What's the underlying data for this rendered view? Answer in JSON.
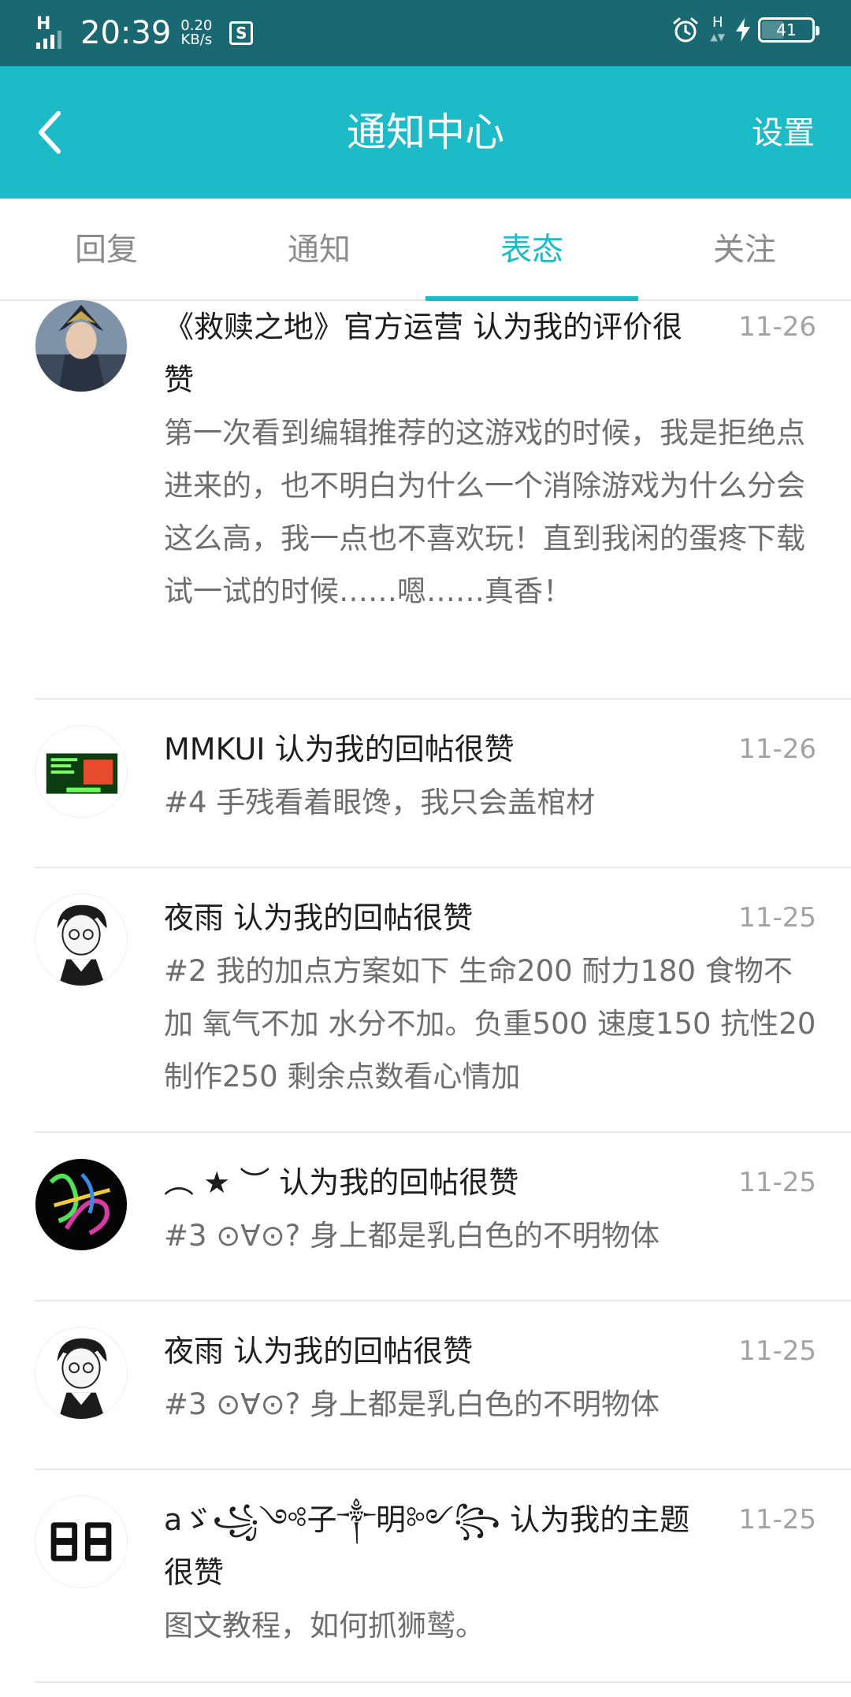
{
  "status_bar": {
    "signal_label": "H",
    "time": "20:39",
    "speed_value": "0.20",
    "speed_unit": "KB/s",
    "app_icon_letter": "S",
    "net_label": "H",
    "battery": "41"
  },
  "header": {
    "title": "通知中心",
    "settings": "设置"
  },
  "tabs": [
    {
      "label": "回复",
      "active": false
    },
    {
      "label": "通知",
      "active": false
    },
    {
      "label": "表态",
      "active": true
    },
    {
      "label": "关注",
      "active": false
    }
  ],
  "colors": {
    "status_bar": "#1a6872",
    "accent": "#1dbac8"
  },
  "notifications": [
    {
      "title": "《救赎之地》官方运营 认为我的评价很赞",
      "date": "11-26",
      "body": "第一次看到编辑推荐的这游戏的时候，我是拒绝点进来的，也不明白为什么一个消除游戏为什么分会这么高，我一点也不喜欢玩！直到我闲的蛋疼下载试一试的时候……嗯……真香！",
      "avatar": "armored-character-avatar"
    },
    {
      "title": "MMKUI 认为我的回帖很赞",
      "date": "11-26",
      "body": "#4 手残看着眼馋，我只会盖棺材",
      "avatar": "green-poster-avatar"
    },
    {
      "title": "夜雨 认为我的回帖很赞",
      "date": "11-25",
      "body": "#2 我的加点方案如下   生命200 耐力180 食物不加 氧气不加 水分不加。负重500 速度150 抗性20 制作250 剩余点数看心情加",
      "avatar": "anime-boy-avatar"
    },
    {
      "title": "︵ ★ ︶  认为我的回帖很赞",
      "date": "11-25",
      "body": "#3 ⊙∀⊙? 身上都是乳白色的不明物体",
      "avatar": "neon-graffiti-avatar"
    },
    {
      "title": "夜雨 认为我的回帖很赞",
      "date": "11-25",
      "body": "#3 ⊙∀⊙? 身上都是乳白色的不明物体",
      "avatar": "anime-boy-avatar"
    },
    {
      "title": "aゞ꧁༺子༒明༻꧂ 认为我的主题很赞",
      "date": "11-25",
      "body": "图文教程，如何抓狮鹫。",
      "avatar": "digital-88-avatar"
    }
  ]
}
